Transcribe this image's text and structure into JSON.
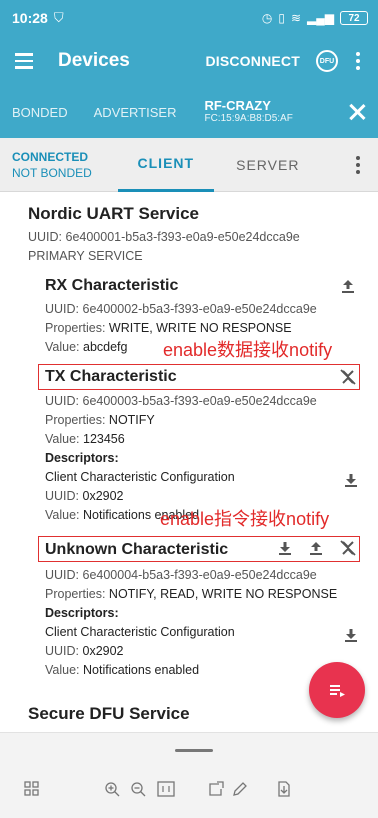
{
  "status_bar": {
    "time": "10:28",
    "battery": "72"
  },
  "toolbar": {
    "title": "Devices",
    "disconnect": "DISCONNECT",
    "dfu": "DFU"
  },
  "device_tabs": {
    "bonded": "BONDED",
    "advertiser": "ADVERTISER",
    "active_name": "RF-CRAZY",
    "active_mac": "FC:15:9A:B8:D5:AF"
  },
  "client_tabs": {
    "connected": "CONNECTED",
    "not_bonded": "NOT BONDED",
    "client": "CLIENT",
    "server": "SERVER"
  },
  "service": {
    "title": "Nordic UART Service",
    "uuid": "UUID: 6e400001-b5a3-f393-e0a9-e50e24dcca9e",
    "type": "PRIMARY SERVICE"
  },
  "rx": {
    "title": "RX Characteristic",
    "uuid": "UUID: 6e400002-b5a3-f393-e0a9-e50e24dcca9e",
    "properties_label": "Properties: ",
    "properties": "WRITE, WRITE NO RESPONSE",
    "value_label": "Value: ",
    "value": "abcdefg"
  },
  "annotations": {
    "first": "enable数据接收notify",
    "second": "enable指令接收notify"
  },
  "tx": {
    "title": "TX Characteristic",
    "uuid": "UUID: 6e400003-b5a3-f393-e0a9-e50e24dcca9e",
    "properties_label": "Properties: ",
    "properties": "NOTIFY",
    "value_label": "Value: ",
    "value": "123456",
    "descriptors": "Descriptors:",
    "desc_name": "Client Characteristic Configuration",
    "desc_uuid_label": "UUID: ",
    "desc_uuid": "0x2902",
    "desc_value_label": "Value: ",
    "desc_value": "Notifications enabled"
  },
  "unknown": {
    "title": "Unknown Characteristic",
    "uuid": "UUID: 6e400004-b5a3-f393-e0a9-e50e24dcca9e",
    "properties_label": "Properties: ",
    "properties": "NOTIFY, READ, WRITE NO RESPONSE",
    "descriptors": "Descriptors:",
    "desc_name": "Client Characteristic Configuration",
    "desc_uuid_label": "UUID: ",
    "desc_uuid": "0x2902",
    "desc_value_label": "Value: ",
    "desc_value": "Notifications enabled"
  },
  "next_service": {
    "title": "Secure DFU Service"
  },
  "colors": {
    "toolbar": "#3fa9c9",
    "accent": "#1a8fb8",
    "annotation": "#e22a2a",
    "fab": "#e8334f"
  }
}
